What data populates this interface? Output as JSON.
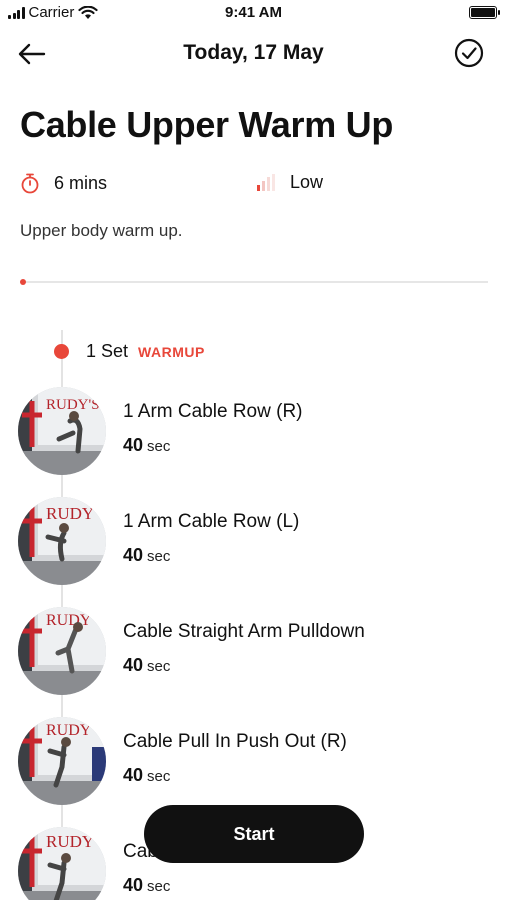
{
  "status_bar": {
    "carrier": "Carrier",
    "time": "9:41 AM"
  },
  "nav": {
    "title": "Today, 17 May",
    "back_icon": "arrow-left-icon",
    "confirm_icon": "check-circle-icon"
  },
  "workout": {
    "title": "Cable Upper Warm Up",
    "duration": "6 mins",
    "level": "Low",
    "description": "Upper body warm up.",
    "progress": 0
  },
  "set": {
    "count_label": "1 Set",
    "tag": "WARMUP"
  },
  "exercises": [
    {
      "name": "1 Arm Cable Row (R)",
      "value": "40",
      "unit": "sec",
      "thumb_text": "RUDY'S"
    },
    {
      "name": "1 Arm Cable Row (L)",
      "value": "40",
      "unit": "sec",
      "thumb_text": "RUDY"
    },
    {
      "name": "Cable Straight Arm Pulldown",
      "value": "40",
      "unit": "sec",
      "thumb_text": "RUDY"
    },
    {
      "name": "Cable Pull In Push Out (R)",
      "value": "40",
      "unit": "sec",
      "thumb_text": "RUDY"
    },
    {
      "name": "Cable Pull In Push Out (L)",
      "value": "40",
      "unit": "sec",
      "thumb_text": "RUDY"
    }
  ],
  "actions": {
    "start_label": "Start"
  },
  "colors": {
    "accent": "#e8473a",
    "button_bg": "#111111"
  }
}
